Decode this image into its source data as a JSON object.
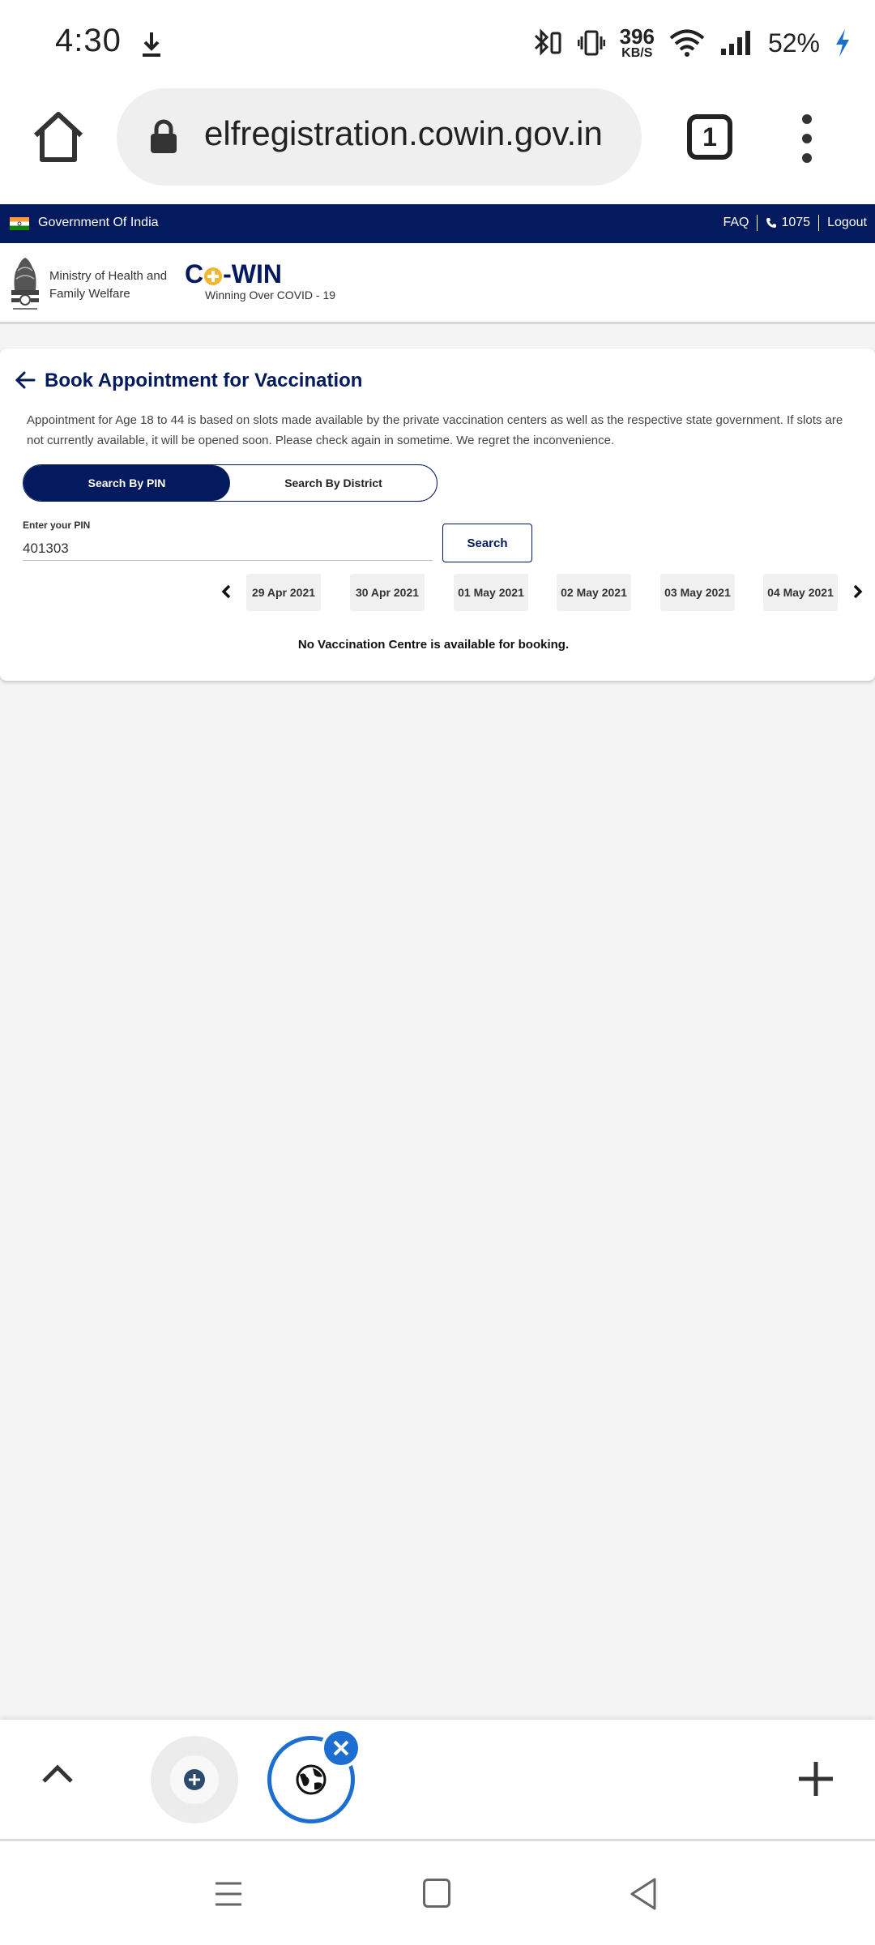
{
  "status_bar": {
    "time": "4:30",
    "speed_value": "396",
    "speed_unit": "KB/S",
    "battery": "52%"
  },
  "browser": {
    "url": "elfregistration.cowin.gov.in",
    "tab_count": "1"
  },
  "gov_bar": {
    "title": "Government Of India",
    "faq": "FAQ",
    "helpline": "1075",
    "logout": "Logout"
  },
  "header": {
    "ministry": "Ministry of Health and Family Welfare",
    "logo_c": "C",
    "logo_rest": "-WIN",
    "tagline": "Winning Over COVID - 19"
  },
  "booking": {
    "title": "Book Appointment for Vaccination",
    "description": "Appointment for Age 18 to 44 is based on slots made available by the private vaccination centers as well as the respective state government. If slots are not currently available, it will be opened soon. Please check again in sometime. We regret the inconvenience.",
    "tabs": [
      "Search By PIN",
      "Search By District"
    ],
    "pin_label": "Enter your PIN",
    "pin_value": "401303",
    "search_label": "Search",
    "dates": [
      "29 Apr 2021",
      "30 Apr 2021",
      "01 May 2021",
      "02 May 2021",
      "03 May 2021",
      "04 May 2021"
    ],
    "no_centre_message": "No Vaccination Centre is available for booking."
  },
  "colors": {
    "brand_navy": "#031a5e",
    "logo_accent": "#f2b632",
    "browser_accent": "#1c6fd1"
  }
}
